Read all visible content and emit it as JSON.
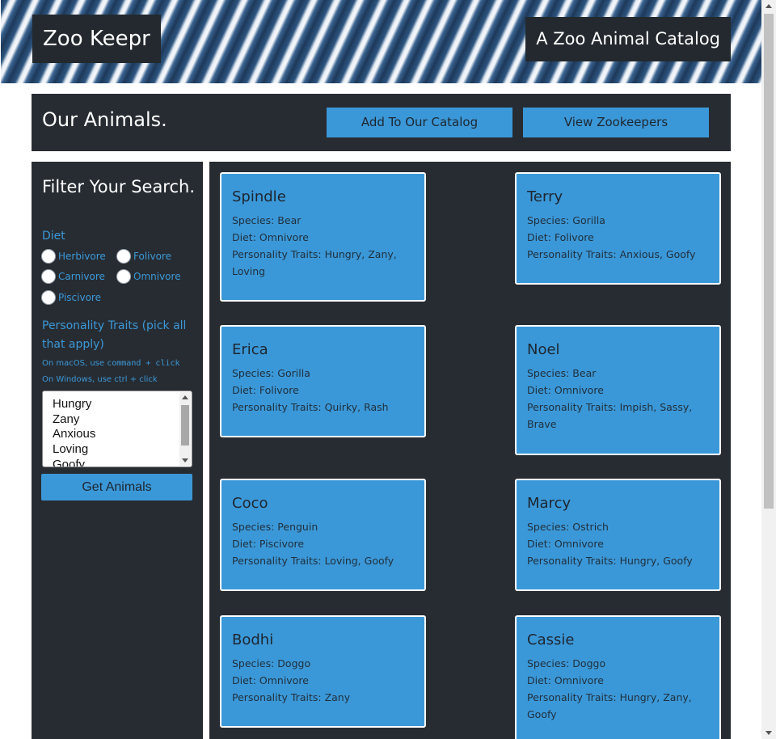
{
  "header": {
    "title": "Zoo Keepr",
    "subtitle": "A Zoo Animal Catalog"
  },
  "top_panel": {
    "heading": "Our Animals.",
    "add_button": "Add To Our Catalog",
    "view_button": "View Zookeepers"
  },
  "sidebar": {
    "heading": "Filter Your Search.",
    "diet_label": "Diet",
    "diet_options": [
      "Herbivore",
      "Folivore",
      "Carnivore",
      "Omnivore",
      "Piscivore"
    ],
    "traits_label": "Personality Traits (pick all that apply)",
    "hint_mac_prefix": "On macOS, use ",
    "hint_mac_code": "command + click",
    "hint_windows": "On Windows, use ctrl + click",
    "traits_options": [
      "Hungry",
      "Zany",
      "Anxious",
      "Loving",
      "Goofy"
    ],
    "get_button": "Get Animals"
  },
  "labels": {
    "species": "Species: ",
    "diet": "Diet: ",
    "traits": "Personality Traits: "
  },
  "animals": [
    {
      "name": "Spindle",
      "species": "Bear",
      "diet": "Omnivore",
      "traits": "Hungry, Zany, Loving"
    },
    {
      "name": "Terry",
      "species": "Gorilla",
      "diet": "Folivore",
      "traits": "Anxious, Goofy"
    },
    {
      "name": "Erica",
      "species": "Gorilla",
      "diet": "Folivore",
      "traits": "Quirky, Rash"
    },
    {
      "name": "Noel",
      "species": "Bear",
      "diet": "Omnivore",
      "traits": "Impish, Sassy, Brave"
    },
    {
      "name": "Coco",
      "species": "Penguin",
      "diet": "Piscivore",
      "traits": "Loving, Goofy"
    },
    {
      "name": "Marcy",
      "species": "Ostrich",
      "diet": "Omnivore",
      "traits": "Hungry, Goofy"
    },
    {
      "name": "Bodhi",
      "species": "Doggo",
      "diet": "Omnivore",
      "traits": "Zany"
    },
    {
      "name": "Cassie",
      "species": "Doggo",
      "diet": "Omnivore",
      "traits": "Hungry, Zany, Goofy"
    }
  ],
  "colors": {
    "accent": "#3b98d8",
    "panel": "#272c32",
    "title_bg": "#23292e"
  }
}
